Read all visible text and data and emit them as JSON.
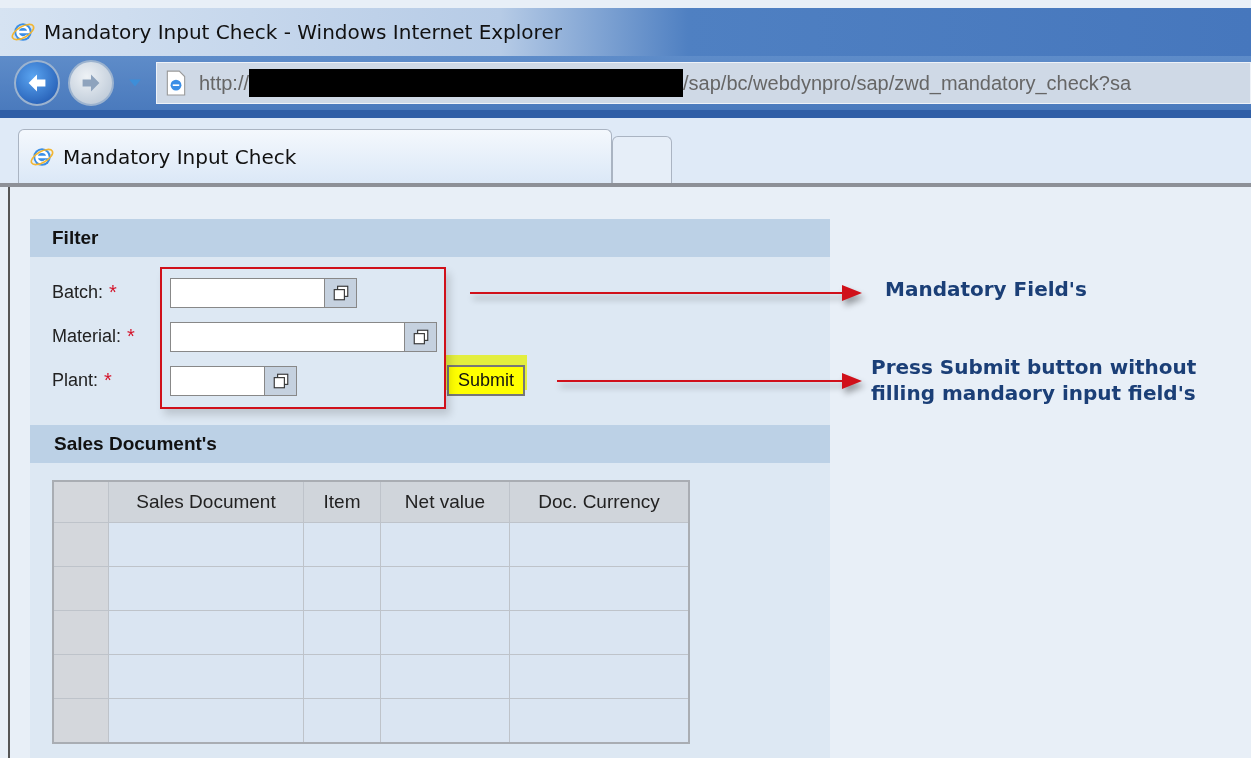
{
  "window": {
    "title": "Mandatory Input Check - Windows Internet Explorer"
  },
  "address_bar": {
    "scheme": "http://",
    "path": "/sap/bc/webdynpro/sap/zwd_mandatory_check?sa"
  },
  "tabs": [
    {
      "label": "Mandatory Input Check",
      "selected": true
    }
  ],
  "filter": {
    "title": "Filter",
    "fields": [
      {
        "label": "Batch:",
        "required": true,
        "required_mark": "*"
      },
      {
        "label": "Material:",
        "required": true,
        "required_mark": "*"
      },
      {
        "label": "Plant:",
        "required": true,
        "required_mark": "*"
      }
    ],
    "submit_button": {
      "label": "Submit",
      "highlighted": true
    }
  },
  "sales_documents": {
    "title": "Sales Document's",
    "columns": [
      "Sales Document",
      "Item",
      "Net value",
      "Doc. Currency"
    ]
  },
  "annotations": [
    {
      "kind": "fields",
      "lines": [
        "Mandatory Field's"
      ]
    },
    {
      "kind": "submit",
      "lines": [
        "Press Submit button without",
        "filling mandaory input field's"
      ]
    }
  ]
}
